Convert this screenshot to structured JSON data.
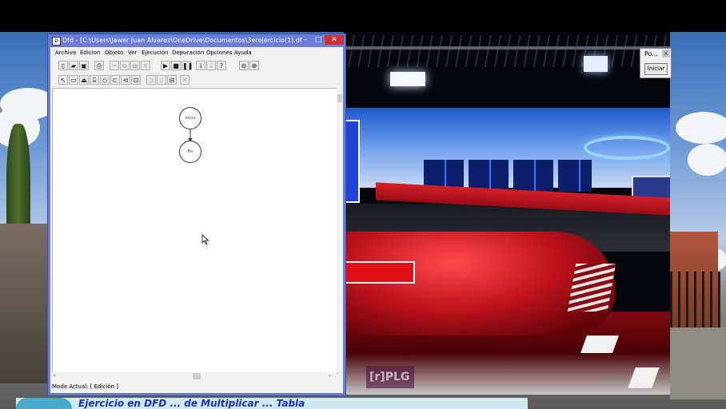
{
  "window": {
    "title": "Dfd - [C:\\Users\\Jawer Juan Alvarez\\OneDrive\\Documentos\\3erejercicio(1).df...",
    "title_icon": "dfd-app-icon",
    "buttons": {
      "minimize": "–",
      "maximize": "□",
      "close": "✕"
    }
  },
  "menu": [
    "Archivo",
    "Edicion",
    "Objeto",
    "Ver",
    "Ejecución",
    "Depuración",
    "Opciones",
    "Ayuda"
  ],
  "toolbar1": [
    {
      "icon": "new-file-icon",
      "glyph": "▯",
      "enabled": true
    },
    {
      "icon": "open-folder-icon",
      "glyph": "▰",
      "enabled": true
    },
    {
      "icon": "save-icon",
      "glyph": "▣",
      "enabled": true
    },
    {
      "icon": "print-icon",
      "glyph": "⎙",
      "enabled": true
    },
    {
      "icon": "cut-icon",
      "glyph": "✂",
      "enabled": false
    },
    {
      "icon": "copy-icon",
      "glyph": "⧉",
      "enabled": false
    },
    {
      "icon": "paste-icon",
      "glyph": "▤",
      "enabled": false
    },
    {
      "icon": "delete-icon",
      "glyph": "✕",
      "enabled": false
    },
    {
      "icon": "run-icon",
      "glyph": "▶",
      "enabled": true
    },
    {
      "icon": "stop-icon",
      "glyph": "■",
      "enabled": true
    },
    {
      "icon": "pause-icon",
      "glyph": "❚❚",
      "enabled": true
    },
    {
      "icon": "step-icon",
      "glyph": "⇂",
      "enabled": true
    },
    {
      "icon": "step-over-icon",
      "glyph": "⇣",
      "enabled": false
    },
    {
      "icon": "evaluate-icon",
      "glyph": "?",
      "enabled": true
    },
    {
      "icon": "zoom-out-icon",
      "glyph": "⊖",
      "enabled": true
    },
    {
      "icon": "zoom-in-icon",
      "glyph": "⊕",
      "enabled": true
    }
  ],
  "toolbar2": [
    {
      "icon": "pointer-tool-icon",
      "glyph": "↖",
      "enabled": true
    },
    {
      "icon": "assignment-tool-icon",
      "glyph": "▭",
      "enabled": true
    },
    {
      "icon": "read-tool-icon",
      "glyph": "⏏",
      "enabled": true
    },
    {
      "icon": "write-tool-icon",
      "glyph": "⌸",
      "enabled": true
    },
    {
      "icon": "decision-tool-icon",
      "glyph": "◇",
      "enabled": true
    },
    {
      "icon": "loop-tool-icon",
      "glyph": "⊏",
      "enabled": true
    },
    {
      "icon": "for-tool-icon",
      "glyph": "⊲",
      "enabled": true
    },
    {
      "icon": "subroutine-tool-icon",
      "glyph": "⊡",
      "enabled": true
    },
    {
      "icon": "end-subroutine-tool-icon",
      "glyph": "⊐",
      "enabled": false
    },
    {
      "icon": "return-tool-icon",
      "glyph": "⌷",
      "enabled": false
    },
    {
      "icon": "call-tool-icon",
      "glyph": "⊟",
      "enabled": true
    },
    {
      "icon": "erase-tool-icon",
      "glyph": "✕",
      "enabled": false
    }
  ],
  "diagram": {
    "start_label": "Inicio",
    "end_label": "Fin"
  },
  "status": "Modo Actual: [ Edición ]",
  "popup": {
    "title": "Po...",
    "close": "x",
    "button": "Iniciar"
  },
  "watermark": "[r]PLG",
  "banner": "Ejercicio en DFD ... de Multiplicar ... Tabla"
}
